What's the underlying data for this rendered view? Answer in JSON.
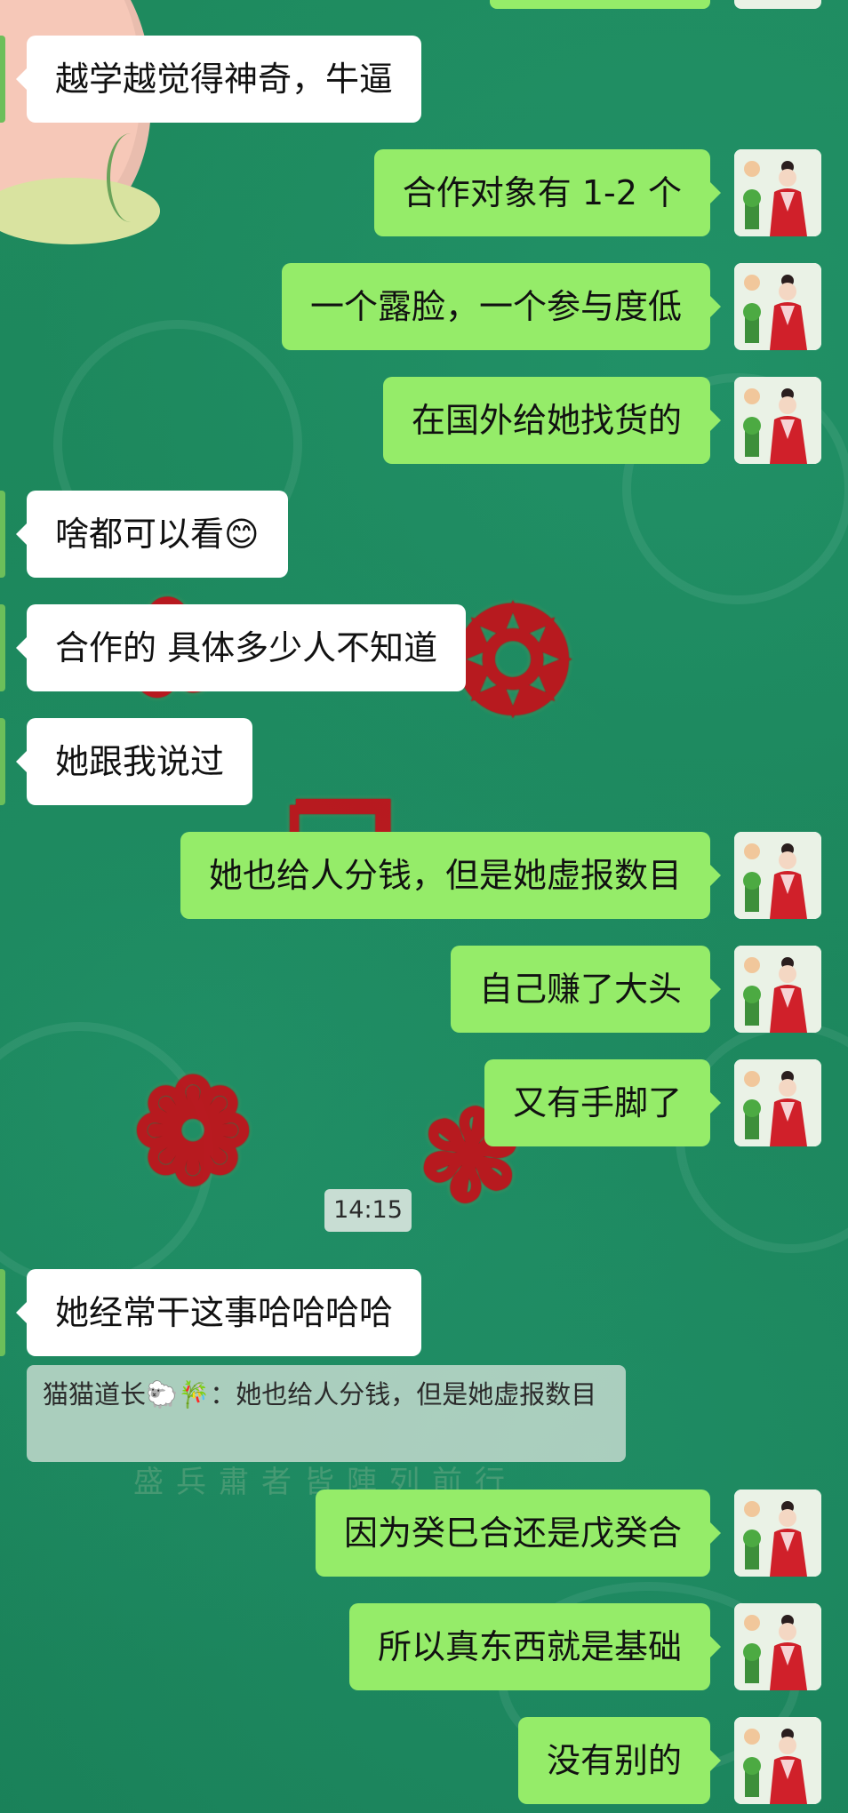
{
  "messages": [
    {
      "side": "in",
      "text": "越学越觉得神奇，牛逼"
    },
    {
      "side": "out",
      "text": "合作对象有 1-2 个"
    },
    {
      "side": "out",
      "text": "一个露脸，一个参与度低"
    },
    {
      "side": "out",
      "text": "在国外给她找货的"
    },
    {
      "side": "in",
      "text": "啥都可以看😊"
    },
    {
      "side": "in",
      "text": "合作的  具体多少人不知道"
    },
    {
      "side": "in",
      "text": "她跟我说过"
    },
    {
      "side": "out",
      "text": "她也给人分钱，但是她虚报数目"
    },
    {
      "side": "out",
      "text": "自己赚了大头"
    },
    {
      "side": "out",
      "text": "又有手脚了"
    },
    {
      "side": "in",
      "text": "她经常干这事哈哈哈哈"
    },
    {
      "side": "out",
      "text": "因为癸巳合还是戊癸合"
    },
    {
      "side": "out",
      "text": "所以真东西就是基础"
    },
    {
      "side": "out",
      "text": "没有别的"
    }
  ],
  "timestamp": "14:15",
  "quote": {
    "text": "猫猫道长🐑🎋：她也给人分钱，但是她虚报数目"
  },
  "background_text": "盛兵肅者皆陣列前行",
  "colors": {
    "background": "#1f8a5f",
    "incoming_bubble": "#ffffff",
    "outgoing_bubble": "#95ec69",
    "decor_red": "#c0141c"
  },
  "icons": {
    "avatar": "user-avatar-red-robe-icon"
  }
}
